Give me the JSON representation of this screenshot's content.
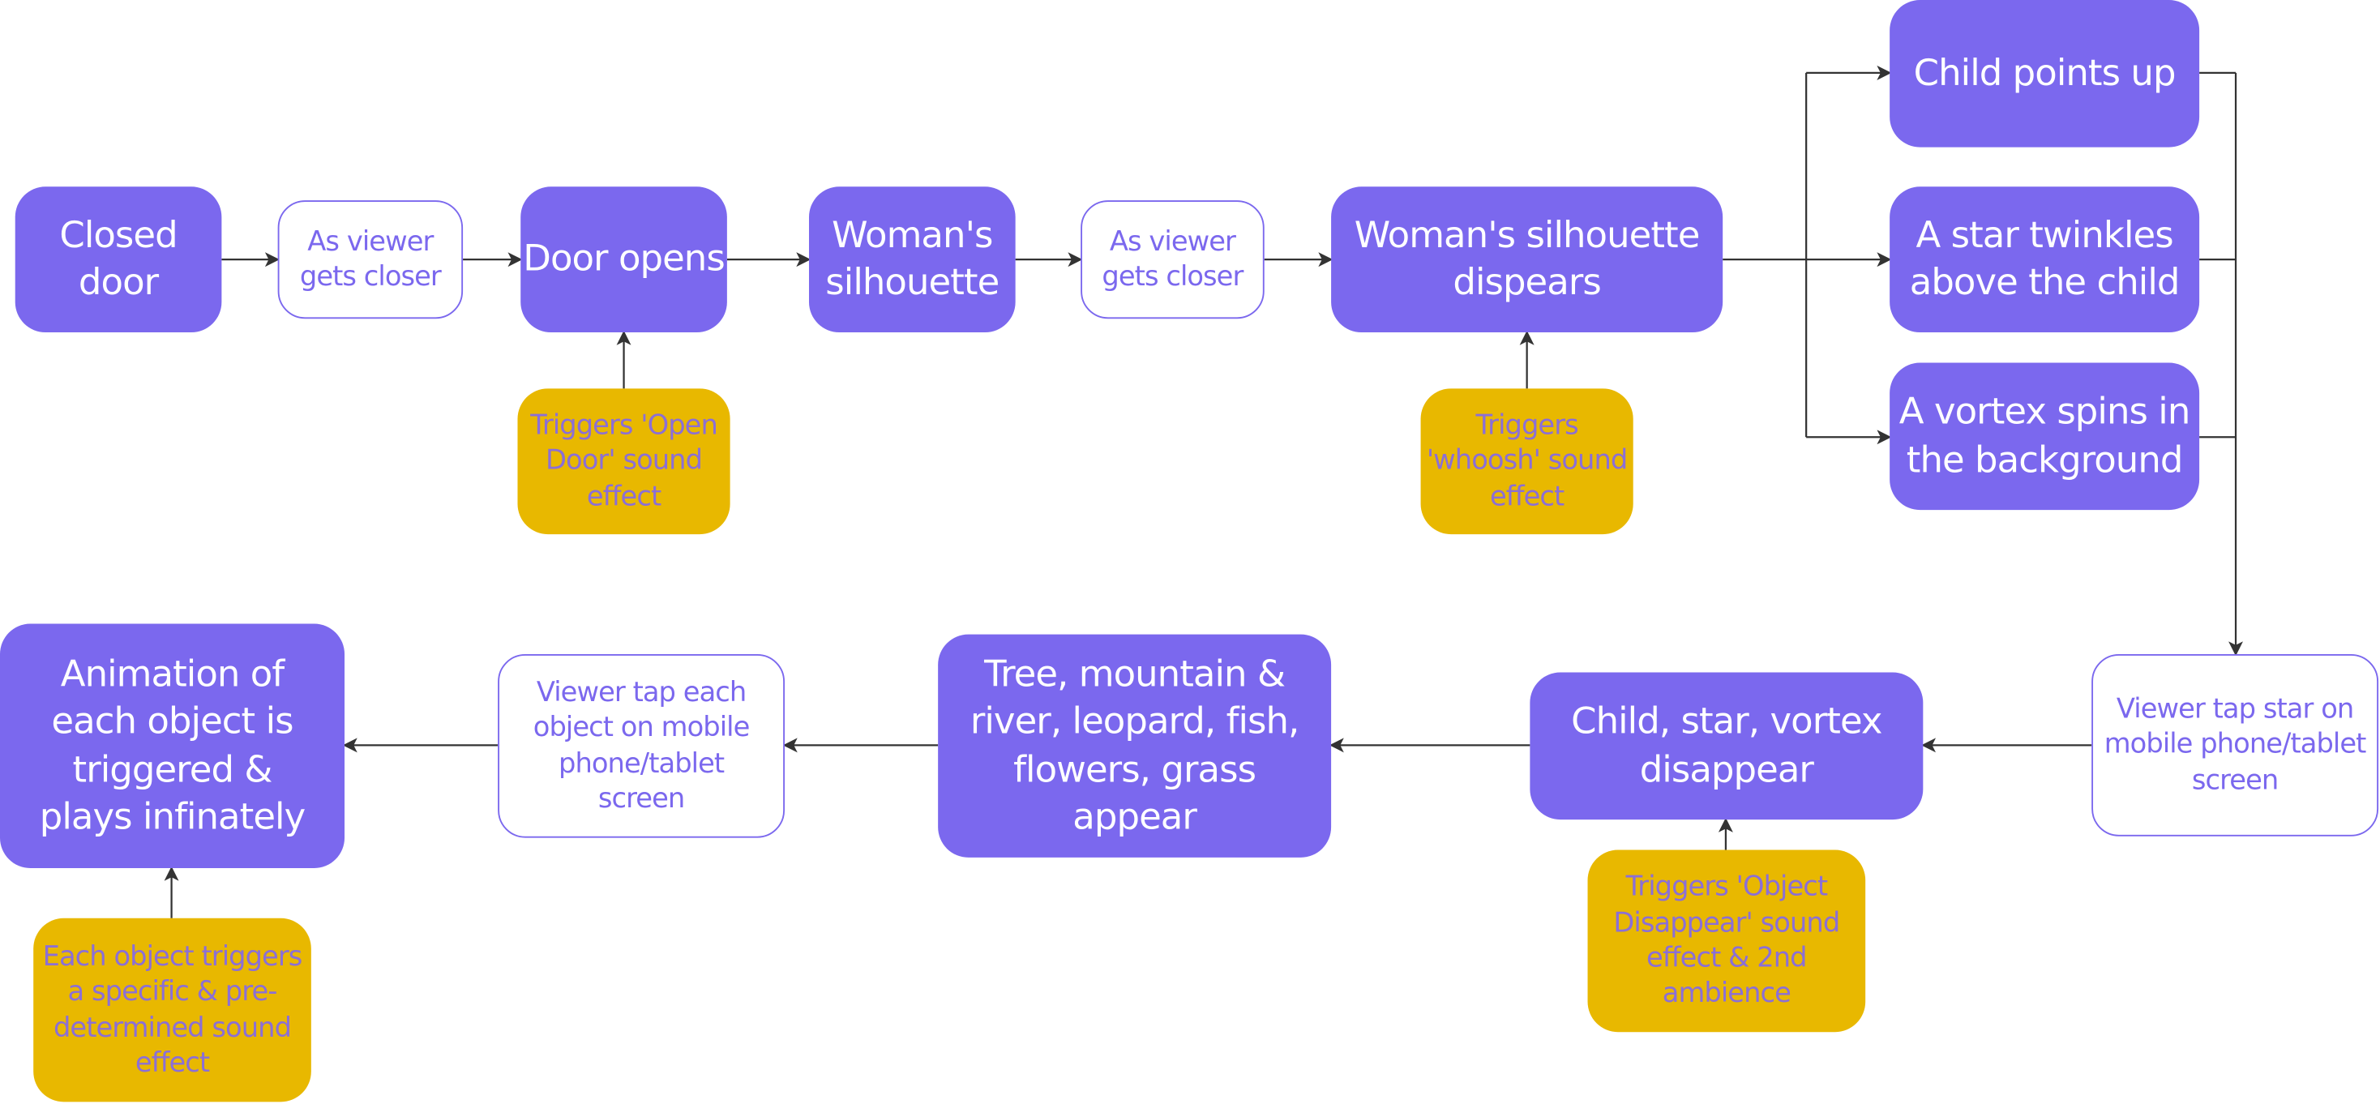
{
  "colors": {
    "step": "#7B68EE",
    "action_border": "#7B68EE",
    "sound": "#E8B800",
    "connector": "#333333"
  },
  "nodes": {
    "closed_door": "Closed door",
    "gets_closer_1": "As viewer gets closer",
    "door_opens": "Door opens",
    "open_door_sound": "Triggers 'Open Door' sound effect",
    "womans_silhouette": "Woman's silhouette",
    "gets_closer_2": "As viewer gets closer",
    "silhouette_dispears": "Woman's silhouette dispears",
    "whoosh_sound": "Triggers 'whoosh' sound effect",
    "child_points_up": "Child points up",
    "star_twinkles": "A star twinkles above the child",
    "vortex_spins": "A vortex spins in the background",
    "tap_star": "Viewer tap star on mobile phone/tablet screen",
    "child_star_vortex_disappear": "Child, star, vortex disappear",
    "object_disappear_sound": "Triggers  'Object Disappear' sound effect & 2nd ambience",
    "objects_appear": "Tree, mountain & river, leopard, fish, flowers, grass appear",
    "tap_each_object": "Viewer tap each object on mobile phone/tablet screen",
    "animation_triggered": "Animation of each object is triggered & plays infinately",
    "specific_sound": "Each object triggers  a specific & pre-determined sound effect"
  }
}
